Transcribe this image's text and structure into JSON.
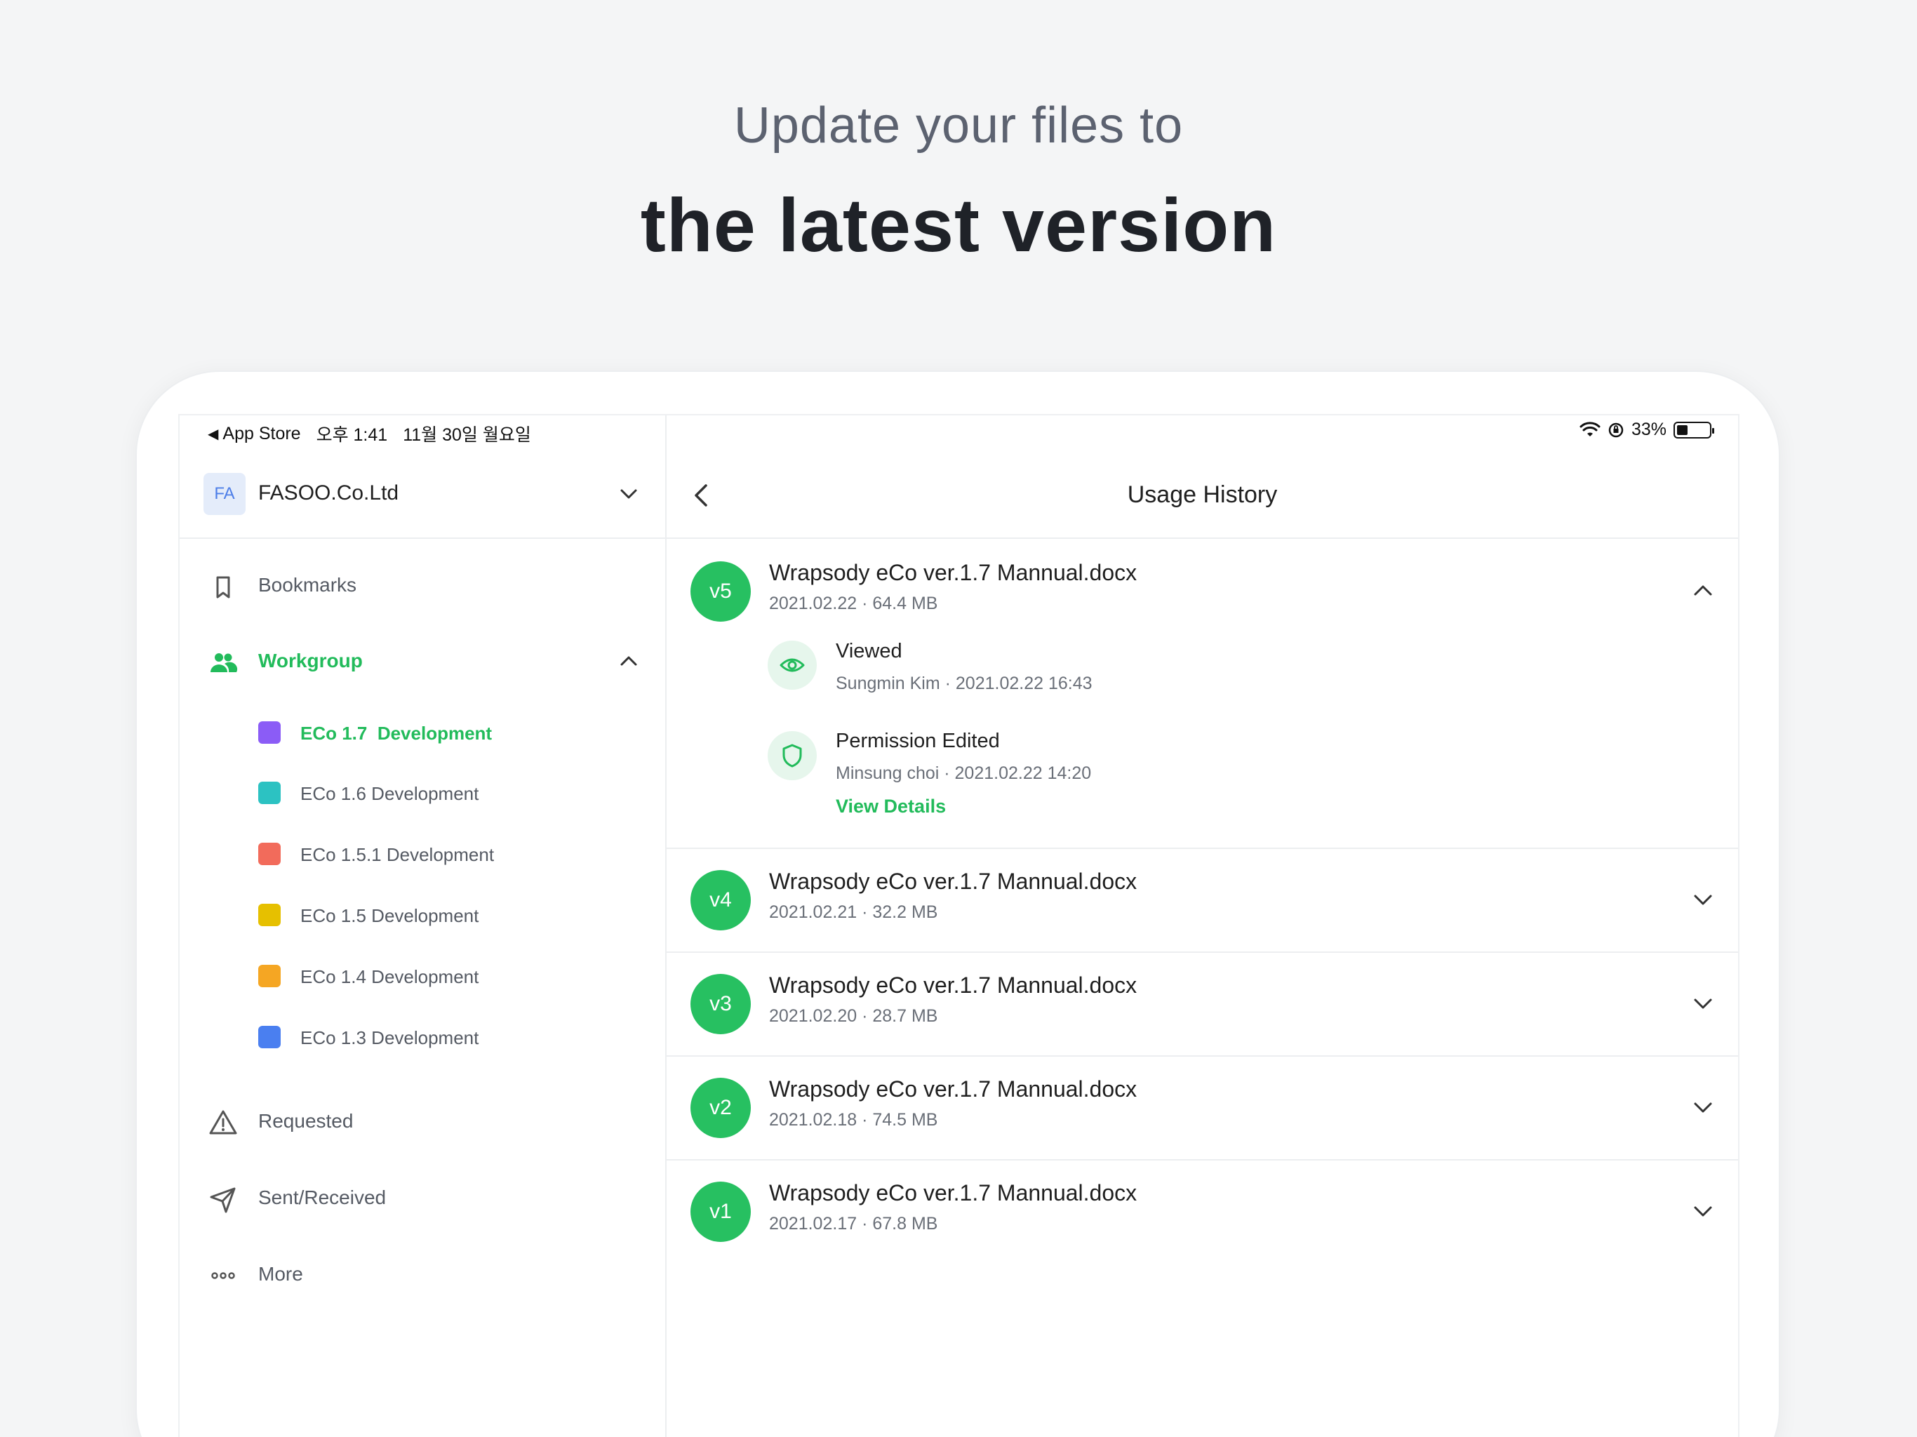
{
  "headline": {
    "line1": "Update your files to",
    "line2": "the latest version"
  },
  "status_bar": {
    "back_app": "App Store",
    "time": "오후 1:41",
    "date": "11월 30일 월요일",
    "battery": "33%",
    "battery_level": 0.33
  },
  "sidebar": {
    "org_initials": "FA",
    "org_name": "FASOO.Co.Ltd",
    "bookmarks": "Bookmarks",
    "workgroup": "Workgroup",
    "workgroups": [
      {
        "label": "ECo 1.7  Development",
        "color": "#8b5cf6"
      },
      {
        "label": "ECo 1.6 Development",
        "color": "#2cc2c2"
      },
      {
        "label": "ECo 1.5.1 Development",
        "color": "#f26b5b"
      },
      {
        "label": "ECo 1.5 Development",
        "color": "#e6c000"
      },
      {
        "label": "ECo 1.4 Development",
        "color": "#f5a623"
      },
      {
        "label": "ECo 1.3 Development",
        "color": "#4a7ff0"
      }
    ],
    "requested": "Requested",
    "sent_received": "Sent/Received",
    "more": "More"
  },
  "main": {
    "title": "Usage History",
    "versions": [
      {
        "badge": "v5",
        "name": "Wrapsody eCo ver.1.7 Mannual.docx",
        "meta": "2021.02.22 · 64.4 MB",
        "expanded": true,
        "activities": [
          {
            "icon": "eye-icon",
            "title": "Viewed",
            "meta": "Sungmin Kim · 2021.02.22 16:43"
          },
          {
            "icon": "shield-icon",
            "title": "Permission Edited",
            "meta": "Minsung choi · 2021.02.22 14:20",
            "link": "View Details"
          }
        ]
      },
      {
        "badge": "v4",
        "name": "Wrapsody eCo ver.1.7 Mannual.docx",
        "meta": "2021.02.21 · 32.2 MB"
      },
      {
        "badge": "v3",
        "name": "Wrapsody eCo ver.1.7 Mannual.docx",
        "meta": "2021.02.20 · 28.7 MB"
      },
      {
        "badge": "v2",
        "name": "Wrapsody eCo ver.1.7 Mannual.docx",
        "meta": "2021.02.18 · 74.5 MB"
      },
      {
        "badge": "v1",
        "name": "Wrapsody eCo ver.1.7 Mannual.docx",
        "meta": "2021.02.17 · 67.8 MB"
      }
    ]
  },
  "colors": {
    "accent": "#22bb5b",
    "badge": "#27c061"
  }
}
